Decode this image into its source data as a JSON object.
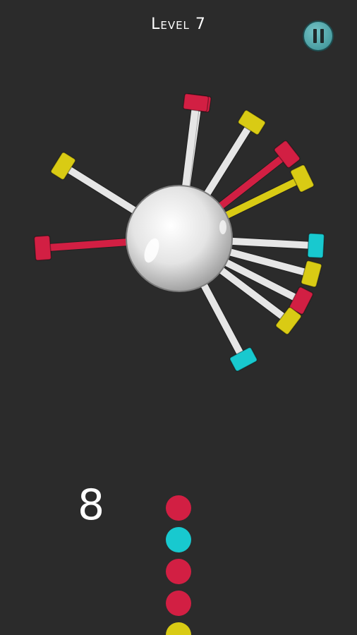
{
  "header": {
    "level_label": "Level 7"
  },
  "pause_button": {
    "icon": "pause-icon",
    "color": "#4a9ea2"
  },
  "colors": {
    "background": "#2b2b2b",
    "red": "#d21f43",
    "yellow": "#d9cb14",
    "cyan": "#18c9cf",
    "rod": "#e6e6e6",
    "hub": "#e8e8e8"
  },
  "wheel": {
    "pins": [
      {
        "angle_deg": -82,
        "color": "red"
      },
      {
        "angle_deg": -58,
        "color": "yellow"
      },
      {
        "angle_deg": -38,
        "color": "red"
      },
      {
        "angle_deg": -26,
        "color": "yellow"
      },
      {
        "angle_deg": 3,
        "color": "cyan"
      },
      {
        "angle_deg": 15,
        "color": "yellow"
      },
      {
        "angle_deg": 27,
        "color": "red"
      },
      {
        "angle_deg": 37,
        "color": "yellow"
      },
      {
        "angle_deg": 62,
        "color": "cyan"
      },
      {
        "angle_deg": 176,
        "color": "red"
      },
      {
        "angle_deg": 212,
        "color": "yellow"
      },
      {
        "angle_deg": 277,
        "color": "red"
      }
    ]
  },
  "queue": {
    "remaining": "8",
    "next_balls": [
      "red",
      "cyan",
      "red",
      "red",
      "yellow"
    ]
  }
}
